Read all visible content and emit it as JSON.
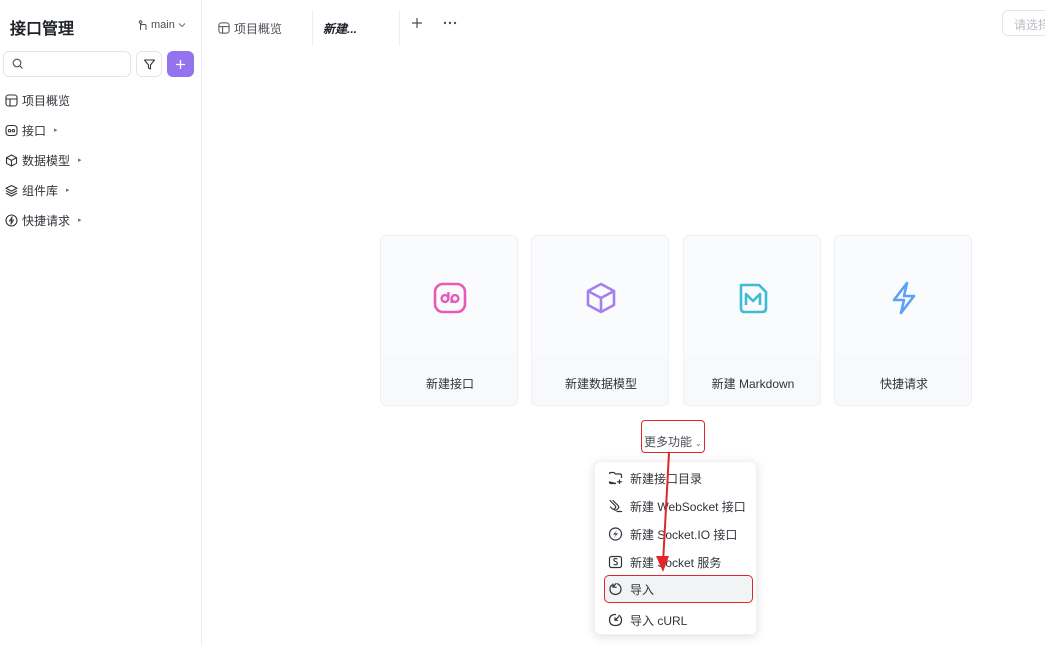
{
  "sidebar": {
    "title": "接口管理",
    "branch": "main",
    "search": {
      "value": "",
      "placeholder": ""
    },
    "nav": [
      {
        "label": "项目概览",
        "icon": "overview-icon",
        "expandable": false
      },
      {
        "label": "接口",
        "icon": "api-icon",
        "expandable": true
      },
      {
        "label": "数据模型",
        "icon": "cube-icon",
        "expandable": true
      },
      {
        "label": "组件库",
        "icon": "layers-icon",
        "expandable": true
      },
      {
        "label": "快捷请求",
        "icon": "bolt-circle-icon",
        "expandable": true
      }
    ]
  },
  "tabs": {
    "items": [
      {
        "label": "项目概览",
        "icon": "overview-icon"
      },
      {
        "label": "新建..."
      }
    ],
    "env_placeholder": "请选择环境"
  },
  "cards": [
    {
      "label": "新建接口",
      "icon": "api-icon",
      "color": "#e95ab8"
    },
    {
      "label": "新建数据模型",
      "icon": "cube-icon",
      "color": "#a57ef0"
    },
    {
      "label": "新建 Markdown",
      "icon": "markdown-icon",
      "color": "#3cbcd6"
    },
    {
      "label": "快捷请求",
      "icon": "bolt-icon",
      "color": "#5aa2f5"
    }
  ],
  "more_functions": "更多功能",
  "menu": {
    "items": [
      {
        "label": "新建接口目录",
        "icon": "folder-plus-icon"
      },
      {
        "label": "新建 WebSocket 接口",
        "icon": "websocket-icon"
      },
      {
        "label": "新建 Socket.IO 接口",
        "icon": "socketio-icon"
      },
      {
        "label": "新建 Socket 服务",
        "icon": "socket-service-icon"
      },
      {
        "label": "导入",
        "icon": "import-icon"
      },
      {
        "label": "导入 cURL",
        "icon": "curl-icon"
      }
    ]
  },
  "colors": {
    "accent": "#9373ee",
    "annotation": "#e0262a"
  }
}
